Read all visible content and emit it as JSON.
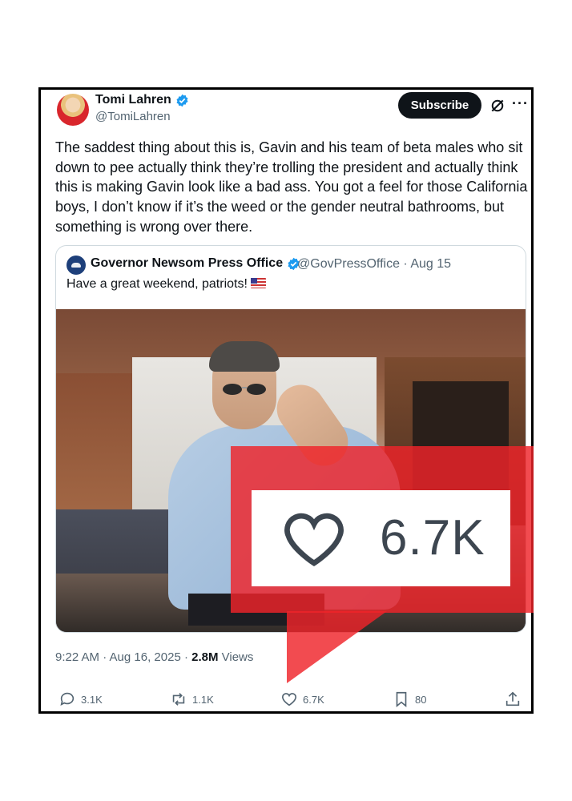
{
  "author": {
    "name": "Tomi Lahren",
    "handle": "@TomiLahren"
  },
  "header": {
    "subscribe_label": "Subscribe"
  },
  "tweet": {
    "text": "The saddest thing about this is, Gavin and his team of beta males who sit down to pee actually think they’re trolling the president and actually think this is making Gavin look like a bad ass. You got a feel for those California boys, I don’t know if it’s the weed or the gender neutral bathrooms, but something is wrong over there."
  },
  "quote": {
    "name": "Governor Newsom Press Office",
    "handle_date": "@GovPressOffice · Aug 15",
    "text": "Have a great weekend, patriots!",
    "emoji": "flag-us-icon"
  },
  "meta": {
    "time_date": "9:22 AM · Aug 16, 2025 · ",
    "views_count": "2.8M",
    "views_label": " Views"
  },
  "actions": {
    "replies": "3.1K",
    "reposts": "1.1K",
    "likes": "6.7K",
    "bookmarks": "80"
  },
  "callout": {
    "likes": "6.7K",
    "icon": "heart-icon"
  },
  "colors": {
    "highlight": "#ef232a",
    "verified": "#1d9bf0",
    "subscribe_bg": "#0f1419"
  }
}
